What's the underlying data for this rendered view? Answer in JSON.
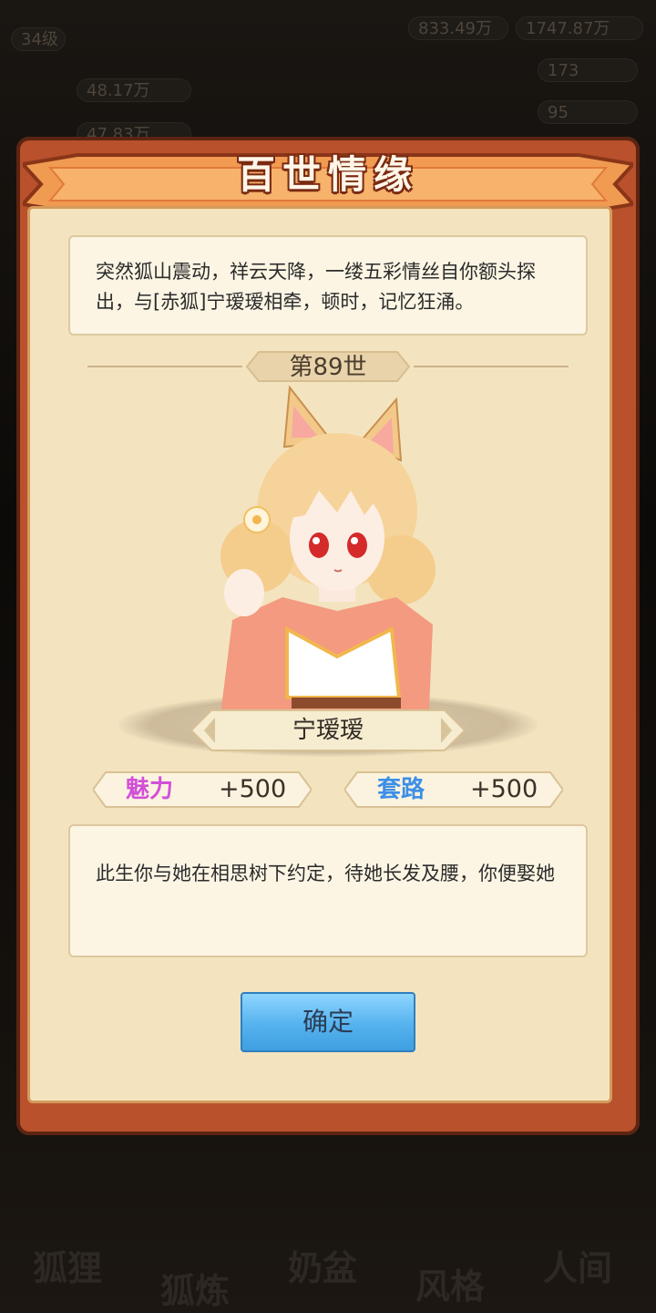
{
  "background": {
    "level": "34级",
    "top_value_1": "833.49万",
    "top_value_2": "1747.87万",
    "left_value_1": "48.17万",
    "left_value_2": "47.83万",
    "right_value_1": "173",
    "right_value_2": "95",
    "nav_items": [
      "狐狸",
      "狐炼",
      "奶盆",
      "风格",
      "人间"
    ]
  },
  "dialog": {
    "title": "百世情缘",
    "intro_text": "突然狐山震动，祥云天降，一缕五彩情丝自你额头探出，与[赤狐]宁瑷瑷相牵，顿时，记忆狂涌。",
    "life_label": "第89世",
    "character_name": "宁瑷瑷",
    "stats": [
      {
        "label": "魅力",
        "value": "+500",
        "color": "#d24fd8"
      },
      {
        "label": "套路",
        "value": "+500",
        "color": "#3d8fe6"
      }
    ],
    "story_text": "此生你与她在相思树下约定，待她长发及腰，你便娶她",
    "confirm_label": "确定"
  },
  "colors": {
    "frame": "#b8512c",
    "panel": "#f3e4bf",
    "button": "#55b2ee"
  }
}
